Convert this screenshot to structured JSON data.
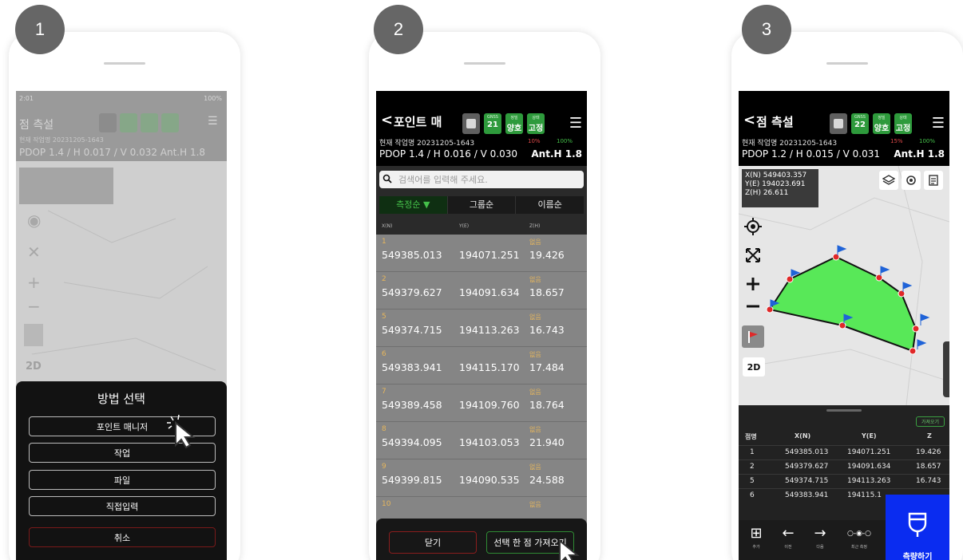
{
  "steps": [
    "1",
    "2",
    "3"
  ],
  "phone1": {
    "status_time": "2:01",
    "status_right": "100%",
    "title": "점 측설",
    "sub": "현재 작업명 20231205-1643",
    "pdop": "PDOP 1.4 / H 0.017 / V 0.032   Ant.H 1.8",
    "side_2d": "2D",
    "sheet_title": "방법 선택",
    "options": [
      "포인트 매니저",
      "작업",
      "파일",
      "직접입력"
    ],
    "cancel": "취소"
  },
  "phone2": {
    "back": "<",
    "title": "포인트 매",
    "chip_sat_label": "GNSS",
    "chip_sat": "21",
    "chip_fix_label": "정밀",
    "chip_fix": "양호",
    "chip_mode_label": "상태",
    "chip_mode": "고정",
    "menu": "☰",
    "sub": "현재 작업명 20231205-1643",
    "batt_phone": "10%",
    "batt_rcv": "100%",
    "pdop": "PDOP 1.4 / H 0.016 / V 0.030",
    "anth": "Ant.H 1.8",
    "search_placeholder": "검색어를 입력해 주세요.",
    "sort_tabs": [
      "측정순 ▼",
      "그룹순",
      "이름순"
    ],
    "columns": [
      "X(N)",
      "Y(E)",
      "Z(H)"
    ],
    "rows": [
      {
        "num": "1",
        "tag": "없음",
        "x": "549385.013",
        "y": "194071.251",
        "z": "19.426"
      },
      {
        "num": "2",
        "tag": "없음",
        "x": "549379.627",
        "y": "194091.634",
        "z": "18.657"
      },
      {
        "num": "5",
        "tag": "없음",
        "x": "549374.715",
        "y": "194113.263",
        "z": "16.743"
      },
      {
        "num": "6",
        "tag": "없음",
        "x": "549383.941",
        "y": "194115.170",
        "z": "17.484"
      },
      {
        "num": "7",
        "tag": "없음",
        "x": "549389.458",
        "y": "194109.760",
        "z": "18.764"
      },
      {
        "num": "8",
        "tag": "없음",
        "x": "549394.095",
        "y": "194103.053",
        "z": "21.940"
      },
      {
        "num": "9",
        "tag": "없음",
        "x": "549399.815",
        "y": "194090.535",
        "z": "24.588"
      },
      {
        "num": "10",
        "tag": "없음",
        "x": "",
        "y": "",
        "z": ""
      }
    ],
    "close": "닫기",
    "select_one": "선택 한 점 가져오기"
  },
  "phone3": {
    "back": "<",
    "title": "점 측설",
    "chip_sat_label": "GNSS",
    "chip_sat": "22",
    "chip_fix_label": "정밀",
    "chip_fix": "양호",
    "chip_mode_label": "상태",
    "chip_mode": "고정",
    "menu": "☰",
    "sub": "현재 작업명 20231205-1643",
    "batt_phone": "15%",
    "batt_rcv": "100%",
    "pdop": "PDOP 1.2 / H 0.015 / V 0.031",
    "anth": "Ant.H 1.8",
    "coord_x": "X(N) 549403.357",
    "coord_y": "Y(E) 194023.691",
    "coord_z": "Z(H) 26.611",
    "btn_2d": "2D",
    "import": "가져오기",
    "table_head": [
      "점명",
      "X(N)",
      "Y(E)",
      "Z"
    ],
    "table_rows": [
      {
        "n": "1",
        "x": "549385.013",
        "y": "194071.251",
        "z": "19.426"
      },
      {
        "n": "2",
        "x": "549379.627",
        "y": "194091.634",
        "z": "18.657"
      },
      {
        "n": "5",
        "x": "549374.715",
        "y": "194113.263",
        "z": "16.743"
      },
      {
        "n": "6",
        "x": "549383.941",
        "y": "194115.1",
        "z": ""
      }
    ],
    "nav": [
      {
        "icon": "⊞",
        "label": "추가"
      },
      {
        "icon": "←",
        "label": "이전"
      },
      {
        "icon": "→",
        "label": "다음"
      },
      {
        "icon": "○-◉-○",
        "label": "최근 측정"
      }
    ],
    "measure": "측량하기"
  },
  "colors": {
    "badge": "#666666",
    "chip_green": "#2e9a3c",
    "sort_active": "#45c04a",
    "row_bg": "#858585",
    "point_number": "#e6b65c",
    "polygon_fill": "#58e858",
    "measure_button": "#0a2cf0",
    "cancel_border": "#8a1d1d"
  }
}
